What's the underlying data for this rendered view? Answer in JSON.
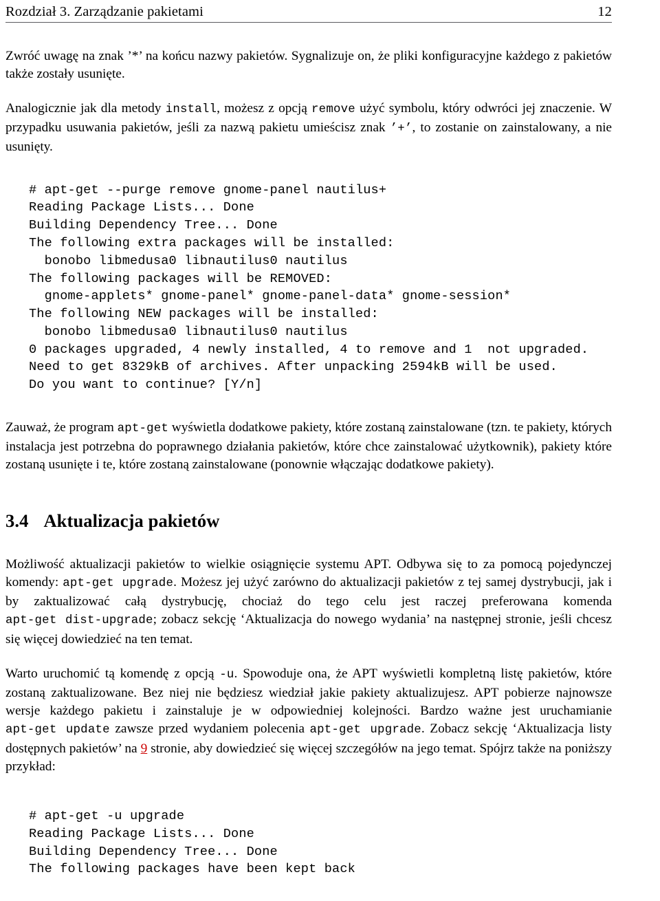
{
  "header": {
    "chapter_title": "Rozdział 3. Zarządzanie pakietami",
    "page_number": "12"
  },
  "body": {
    "para_1": "Zwróć uwagę na znak ’*’ na końcu nazwy pakietów. Sygnalizuje on, że pliki konfiguracyjne każdego z pakietów także zostały usunięte.",
    "para_2_part_1": "Analogicznie jak dla metody ",
    "para_2_code_1": "install",
    "para_2_part_2": ", możesz z opcją ",
    "para_2_code_2": "remove",
    "para_2_part_3": " użyć symbolu, który odwróci jej znaczenie. W przypadku usuwania pakietów, jeśli za nazwą pakietu umieścisz znak ",
    "para_2_code_3": "’+’",
    "para_2_part_4": ", to zostanie on zainstalowany, a nie usunięty.",
    "terminal_1": "# apt-get --purge remove gnome-panel nautilus+\nReading Package Lists... Done\nBuilding Dependency Tree... Done\nThe following extra packages will be installed:\n  bonobo libmedusa0 libnautilus0 nautilus\nThe following packages will be REMOVED:\n  gnome-applets* gnome-panel* gnome-panel-data* gnome-session*\nThe following NEW packages will be installed:\n  bonobo libmedusa0 libnautilus0 nautilus\n0 packages upgraded, 4 newly installed, 4 to remove and 1  not upgraded.\nNeed to get 8329kB of archives. After unpacking 2594kB will be used.\nDo you want to continue? [Y/n]",
    "para_3_part_1": "Zauważ, że program ",
    "para_3_code_1": "apt-get",
    "para_3_part_2": " wyświetla dodatkowe pakiety, które zostaną zainstalowane (tzn. te pakiety, których instalacja jest potrzebna do poprawnego działania pakietów, które chce zainstalować użytkownik), pakiety które zostaną usunięte i te, które zostaną zainstalowane (ponownie włączając dodatkowe pakiety)."
  },
  "section": {
    "number": "3.4",
    "title": "Aktualizacja pakietów",
    "para_1_part_1": "Możliwość aktualizacji pakietów to wielkie osiągnięcie systemu APT. Odbywa się to za pomocą pojedynczej komendy: ",
    "para_1_code_1": "apt-get upgrade",
    "para_1_part_2": ". Możesz jej użyć zarówno do aktualizacji pakietów z tej samej dystrybucji, jak i by zaktualizować całą dystrybucję, chociaż do tego celu jest raczej preferowana komenda ",
    "para_1_code_2": "apt-get dist-upgrade",
    "para_1_part_3": "; zobacz sekcję ‘Aktualizacja do nowego wydania’ na następnej stronie, jeśli chcesz się więcej dowiedzieć na ten temat.",
    "para_2_part_1": "Warto uruchomić tą komendę z opcją ",
    "para_2_code_1": "-u",
    "para_2_part_2": ". Spowoduje ona, że APT wyświetli kompletną listę pakietów, które zostaną zaktualizowane. Bez niej nie będziesz wiedział jakie pakiety aktualizujesz. APT pobierze najnowsze wersje każdego pakietu i zainstaluje je w odpowiedniej kolejności. Bardzo ważne jest uruchamianie ",
    "para_2_code_2": "apt-get update",
    "para_2_part_3": " zawsze przed wydaniem polecenia ",
    "para_2_code_3": "apt-get upgrade",
    "para_2_part_4": ". Zobacz sekcję ‘Aktualizacja listy dostępnych pakietów’ na ",
    "para_2_link": "9",
    "para_2_part_5": " stronie, aby dowiedzieć się więcej szczegółów na jego temat. Spójrz także na poniższy przykład:",
    "terminal_2": "# apt-get -u upgrade\nReading Package Lists... Done\nBuilding Dependency Tree... Done\nThe following packages have been kept back"
  },
  "colors": {
    "link": "#cc0000",
    "rule": "#59595e",
    "text": "#000000"
  }
}
